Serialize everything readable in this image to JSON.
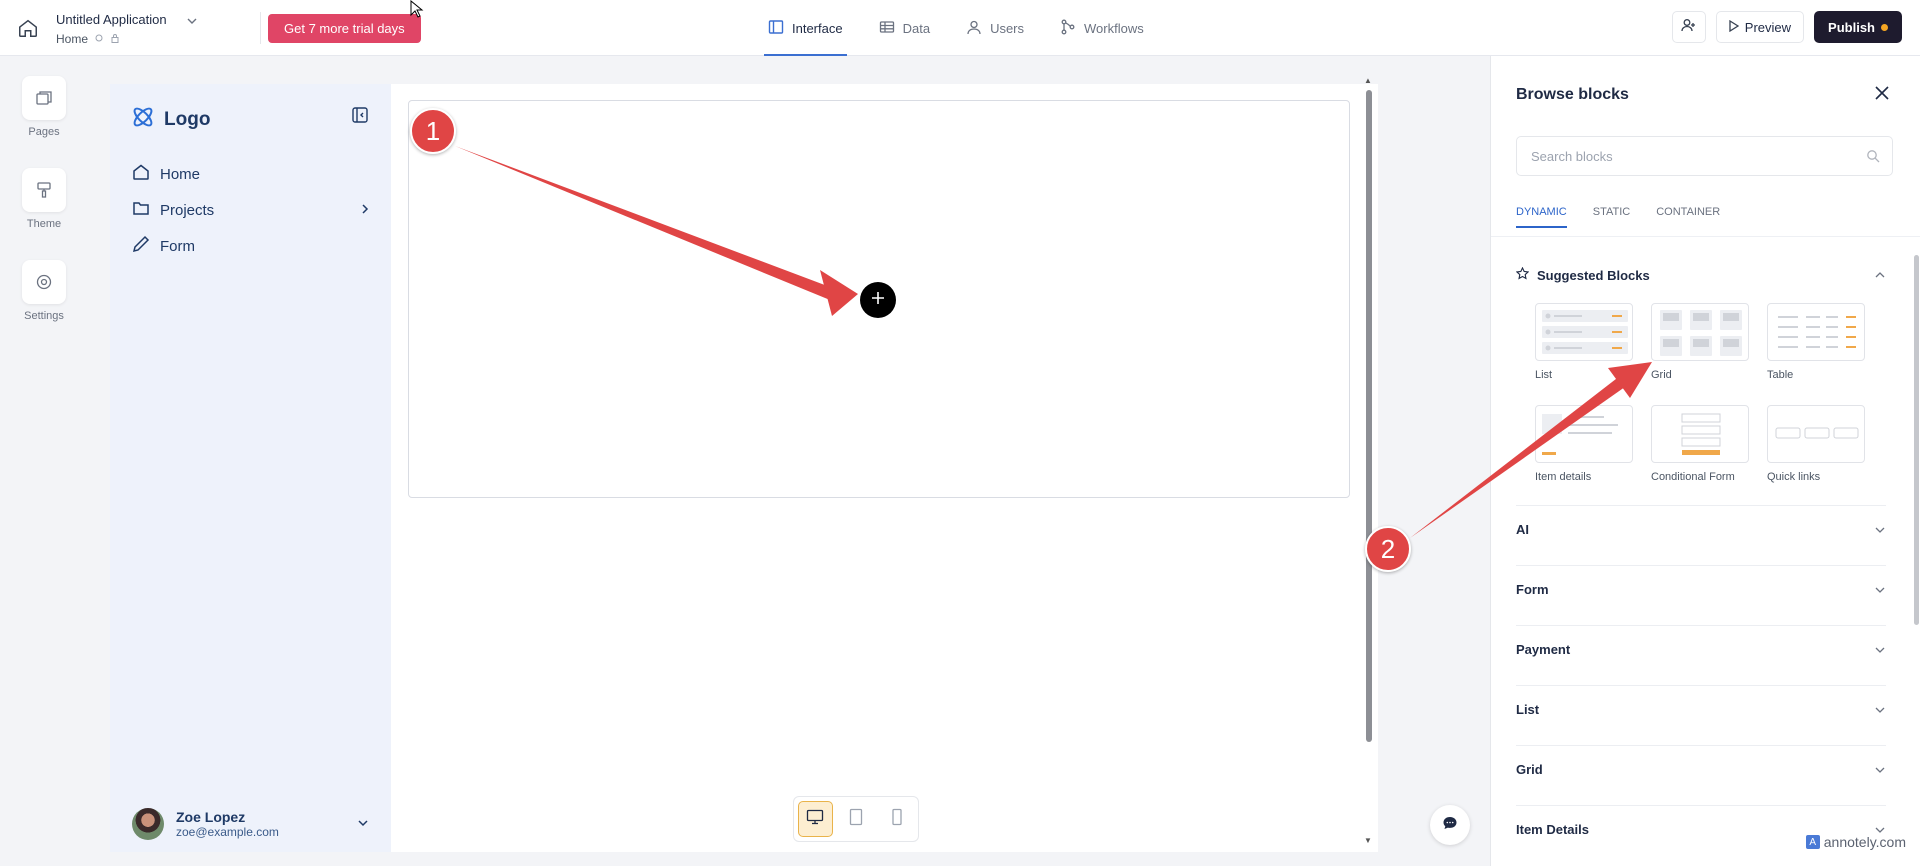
{
  "topbar": {
    "app_title": "Untitled Application",
    "app_subtitle": "Home",
    "trial_button": "Get 7 more trial days",
    "tabs": [
      {
        "label": "Interface",
        "icon": "layout-icon",
        "active": true
      },
      {
        "label": "Data",
        "icon": "table-icon",
        "active": false
      },
      {
        "label": "Users",
        "icon": "user-icon",
        "active": false
      },
      {
        "label": "Workflows",
        "icon": "workflow-icon",
        "active": false
      }
    ],
    "preview_label": "Preview",
    "publish_label": "Publish"
  },
  "leftrail": {
    "items": [
      {
        "label": "Pages",
        "icon": "pages-icon"
      },
      {
        "label": "Theme",
        "icon": "paint-roller-icon"
      },
      {
        "label": "Settings",
        "icon": "gear-icon"
      }
    ]
  },
  "app_sidebar": {
    "logo_text": "Logo",
    "menu": [
      {
        "label": "Home",
        "icon": "home-icon"
      },
      {
        "label": "Projects",
        "icon": "folder-icon"
      },
      {
        "label": "Form",
        "icon": "pen-icon"
      }
    ],
    "user": {
      "name": "Zoe Lopez",
      "email": "zoe@example.com"
    }
  },
  "right_panel": {
    "title": "Browse blocks",
    "search_placeholder": "Search blocks",
    "tabs": [
      {
        "label": "DYNAMIC",
        "active": true
      },
      {
        "label": "STATIC",
        "active": false
      },
      {
        "label": "CONTAINER",
        "active": false
      }
    ],
    "suggested_title": "Suggested Blocks",
    "blocks": [
      {
        "label": "List"
      },
      {
        "label": "Grid"
      },
      {
        "label": "Table"
      },
      {
        "label": "Item details"
      },
      {
        "label": "Conditional Form"
      },
      {
        "label": "Quick links"
      }
    ],
    "sections": [
      "AI",
      "Form",
      "Payment",
      "List",
      "Grid",
      "Item Details"
    ]
  },
  "annotations": {
    "badge_1": "1",
    "badge_2": "2"
  },
  "watermark": "annotely.com",
  "colors": {
    "accent": "#3b6fd1",
    "trial": "#e04566",
    "publish": "#1e1b2e",
    "annotation": "#e04545"
  }
}
